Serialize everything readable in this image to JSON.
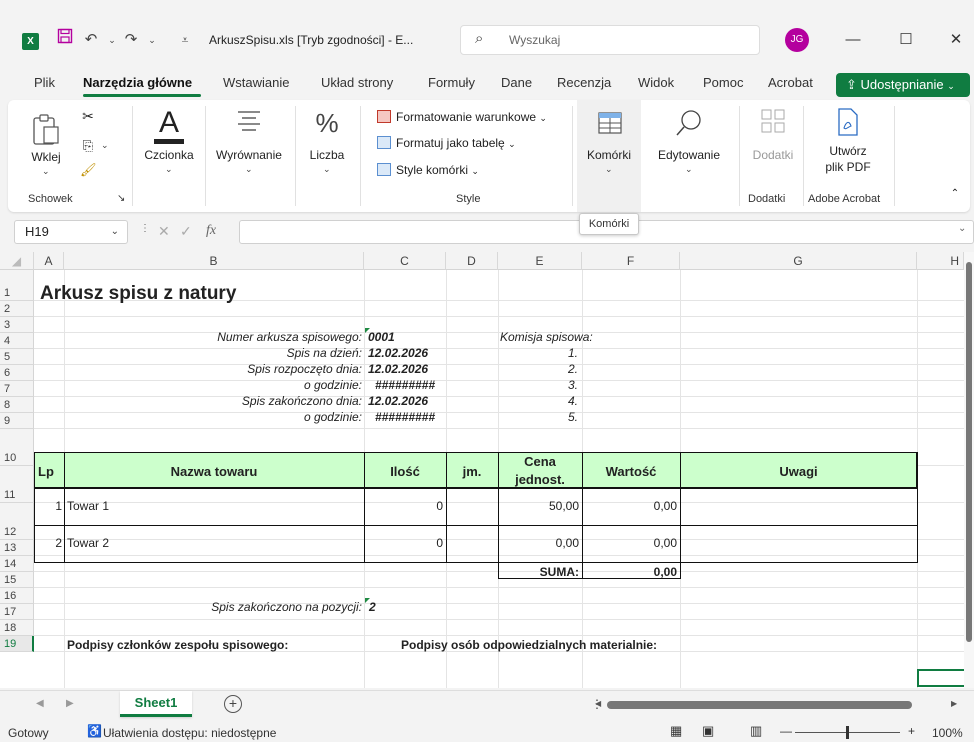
{
  "window": {
    "app_icon": "X",
    "title": "ArkuszSpisu.xls [Tryb zgodności] - E...",
    "search_placeholder": "Wyszukaj",
    "user_initials": "JG",
    "minimize_glyph": "—",
    "maximize_glyph": "☐",
    "close_glyph": "✕"
  },
  "menu": {
    "tabs": [
      "Plik",
      "Narzędzia główne",
      "Wstawianie",
      "Układ strony",
      "Formuły",
      "Dane",
      "Recenzja",
      "Widok",
      "Pomoc",
      "Acrobat"
    ],
    "active_index": 1,
    "share_label": "Udostępnianie"
  },
  "ribbon": {
    "paste_label": "Wklej",
    "font_label": "Czcionka",
    "alignment_label": "Wyrównanie",
    "number_label": "Liczba",
    "conditional_formatting_label": "Formatowanie warunkowe",
    "format_as_table_label": "Formatuj jako tabelę",
    "cell_styles_label": "Style komórki",
    "cells_label": "Komórki",
    "editing_label": "Edytowanie",
    "addins_label": "Dodatki",
    "create_pdf_line1": "Utwórz",
    "create_pdf_line2": "plik PDF",
    "groups": {
      "clipboard": "Schowek",
      "styles": "Style",
      "addins": "Dodatki",
      "adobe": "Adobe Acrobat"
    }
  },
  "tooltip": "Komórki",
  "formula_bar": {
    "name_box": "H19",
    "fx": "fx",
    "content": ""
  },
  "grid": {
    "columns": [
      "A",
      "B",
      "C",
      "D",
      "E",
      "F",
      "G",
      "H"
    ],
    "rows": [
      "1",
      "2",
      "3",
      "4",
      "5",
      "6",
      "7",
      "8",
      "9",
      "10",
      "11",
      "12",
      "13",
      "14",
      "15",
      "16",
      "17",
      "18",
      "19"
    ],
    "selected_row": "19"
  },
  "sheet": {
    "title": "Arkusz spisu z natury",
    "number_label": "Numer arkusza spisowego:",
    "number_value": "0001",
    "date_label": "Spis na dzień:",
    "date_value": "12.02.2026",
    "start_label": "Spis rozpoczęto dnia:",
    "start_value": "12.02.2026",
    "start_time_label": "o godzinie:",
    "start_time_value": "#########",
    "end_label": "Spis zakończono dnia:",
    "end_value": "12.02.2026",
    "end_time_label": "o godzinie:",
    "end_time_value": "#########",
    "commission_label": "Komisja spisowa:",
    "commission_numbers": [
      "1.",
      "2.",
      "3.",
      "4.",
      "5."
    ],
    "table_headers": {
      "lp": "Lp",
      "name": "Nazwa towaru",
      "qty": "Ilość",
      "unit": "jm.",
      "price_line1": "Cena",
      "price_line2": "jednost.",
      "value": "Wartość",
      "notes": "Uwagi"
    },
    "items": [
      {
        "lp": "1",
        "name": "Towar 1",
        "qty": "0",
        "unit": "",
        "price": "50,00",
        "value": "0,00",
        "notes": ""
      },
      {
        "lp": "2",
        "name": "Towar 2",
        "qty": "0",
        "unit": "",
        "price": "0,00",
        "value": "0,00",
        "notes": ""
      }
    ],
    "sum_label": "SUMA:",
    "sum_value": "0,00",
    "finished_label": "Spis zakończono na pozycji:",
    "finished_value": "2",
    "signatures_team": "Podpisy członków zespołu spisowego:",
    "signatures_responsible": "Podpisy osób odpowiedzialnych materialnie:"
  },
  "sheet_tabs": {
    "active": "Sheet1",
    "add_glyph": "+"
  },
  "status": {
    "ready": "Gotowy",
    "accessibility": "Ułatwienia dostępu: niedostępne",
    "zoom": "100%",
    "zoom_minus": "—",
    "zoom_plus": "+"
  },
  "colors": {
    "accent": "#107c41",
    "table_header_fill": "#ccffcc",
    "avatar": "#b4009e"
  }
}
